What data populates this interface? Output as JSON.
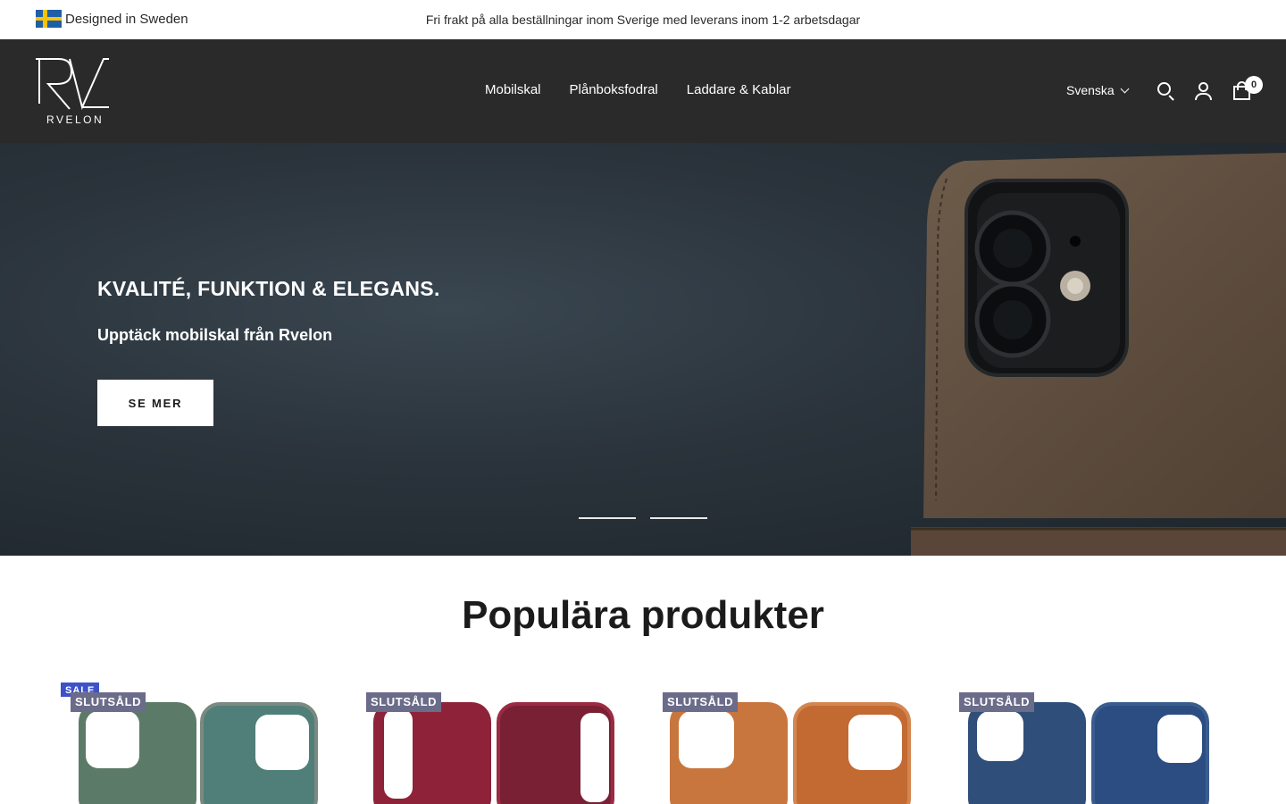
{
  "announcement": {
    "left_text": "Designed in Sweden",
    "center_text": "Fri frakt på alla beställningar inom Sverige med leverans inom 1-2 arbetsdagar"
  },
  "header": {
    "logo_text": "RVELON",
    "nav": [
      "Mobilskal",
      "Plånboksfodral",
      "Laddare & Kablar"
    ],
    "language": "Svenska",
    "cart_count": "0"
  },
  "hero": {
    "title": "KVALITÉ, FUNKTION & ELEGANS.",
    "subtitle": "Upptäck mobilskal från Rvelon",
    "button": "SE MER",
    "slides": 2
  },
  "products_section": {
    "title": "Populära produkter",
    "products": [
      {
        "sale_label": "SALE",
        "sold_out_label": "SLUTSÅLD",
        "color": "#5c7a68",
        "color_inside": "#4f7f78"
      },
      {
        "sold_out_label": "SLUTSÅLD",
        "color": "#8e2238",
        "color_inside": "#7a2035"
      },
      {
        "sold_out_label": "SLUTSÅLD",
        "color": "#c8763e",
        "color_inside": "#c26a32"
      },
      {
        "sold_out_label": "SLUTSÅLD",
        "color": "#2f4f7a",
        "color_inside": "#2c4d82"
      }
    ]
  }
}
